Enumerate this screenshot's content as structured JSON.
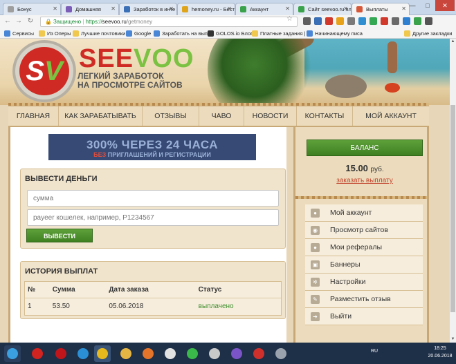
{
  "browser": {
    "tabs": [
      {
        "label": "Бонус",
        "active": false,
        "favicon_color": "#9e9e9e"
      },
      {
        "label": "Домашняя",
        "active": false,
        "favicon_color": "#7b5db8"
      },
      {
        "label": "Заработок в инте",
        "active": false,
        "favicon_color": "#3b6fb6"
      },
      {
        "label": "hemoney.ru - Бест",
        "active": false,
        "favicon_color": "#e0a41b"
      },
      {
        "label": "Аккаунт",
        "active": false,
        "favicon_color": "#3aa24a"
      },
      {
        "label": "Сайт seevoo.ru пл",
        "active": false,
        "favicon_color": "#3aa24a"
      },
      {
        "label": "Выплаты",
        "active": true,
        "favicon_color": "#d55838"
      }
    ],
    "address": {
      "secure_label": "Защищено",
      "scheme": "https://",
      "host": "seevoo.ru",
      "path": "/getmoney"
    },
    "bookmarks": [
      {
        "label": "Сервисы",
        "color": "#4a86d6"
      },
      {
        "label": "Из Оперы",
        "color": "#f0c84e"
      },
      {
        "label": "Лучшие почтовики",
        "color": "#f0c84e"
      },
      {
        "label": "Google",
        "color": "#4a86d6"
      },
      {
        "label": "Заработать на выпл",
        "color": "#4a86d6"
      },
      {
        "label": "GOLOS.io Блоги",
        "color": "#333"
      },
      {
        "label": "Платные задания |",
        "color": "#f0c84e"
      },
      {
        "label": "Начинающему писа",
        "color": "#4a86d6"
      },
      {
        "label": "Другие закладки",
        "color": "#f0c84e"
      }
    ]
  },
  "site": {
    "logo_text": "SV",
    "brand": {
      "part1": "SEE",
      "part2": "VOO"
    },
    "tagline_1": "ЛЕГКИЙ ЗАРАБОТОК",
    "tagline_2": "НА ПРОСМОТРЕ САЙТОВ",
    "nav": [
      {
        "label": "ГЛАВНАЯ"
      },
      {
        "label": "КАК ЗАРАБАТЫВАТЬ"
      },
      {
        "label": "ОТЗЫВЫ"
      },
      {
        "label": "ЧАВО"
      },
      {
        "label": "НОВОСТИ"
      },
      {
        "label": "КОНТАКТЫ"
      },
      {
        "label": "МОЙ АККАУНТ"
      }
    ],
    "banner": {
      "line1": "300% ЧЕРЕЗ 24 ЧАСА",
      "line2_red": "БЕЗ",
      "line2_rest": " ПРИГЛАШЕНИЙ И РЕГИСТРАЦИИ"
    },
    "withdraw": {
      "title": "ВЫВЕСТИ ДЕНЬГИ",
      "amount_placeholder": "сумма",
      "wallet_placeholder": "payeer кошелек, например, P1234567",
      "button": "ВЫВЕСТИ"
    },
    "history": {
      "title": "ИСТОРИЯ ВЫПЛАТ",
      "columns": [
        "№",
        "Сумма",
        "Дата заказа",
        "Статус"
      ],
      "rows": [
        {
          "num": "1",
          "amount": "53.50",
          "date": "05.06.2018",
          "status": "выплачено"
        }
      ]
    },
    "balance": {
      "button": "БАЛАНС",
      "value": "15.00",
      "currency": "руб.",
      "order_link": "заказать выплату"
    },
    "menu": [
      {
        "label": "Мой аккаунт",
        "icon": "user-icon"
      },
      {
        "label": "Просмотр сайтов",
        "icon": "eye-icon"
      },
      {
        "label": "Мои рефералы",
        "icon": "users-icon"
      },
      {
        "label": "Баннеры",
        "icon": "image-icon"
      },
      {
        "label": "Настройки",
        "icon": "gear-icon"
      },
      {
        "label": "Разместить отзыв",
        "icon": "comment-icon"
      },
      {
        "label": "Выйти",
        "icon": "logout-icon"
      }
    ]
  },
  "taskbar": {
    "language": "RU",
    "time": "18:25",
    "date": "20.06.2018"
  }
}
